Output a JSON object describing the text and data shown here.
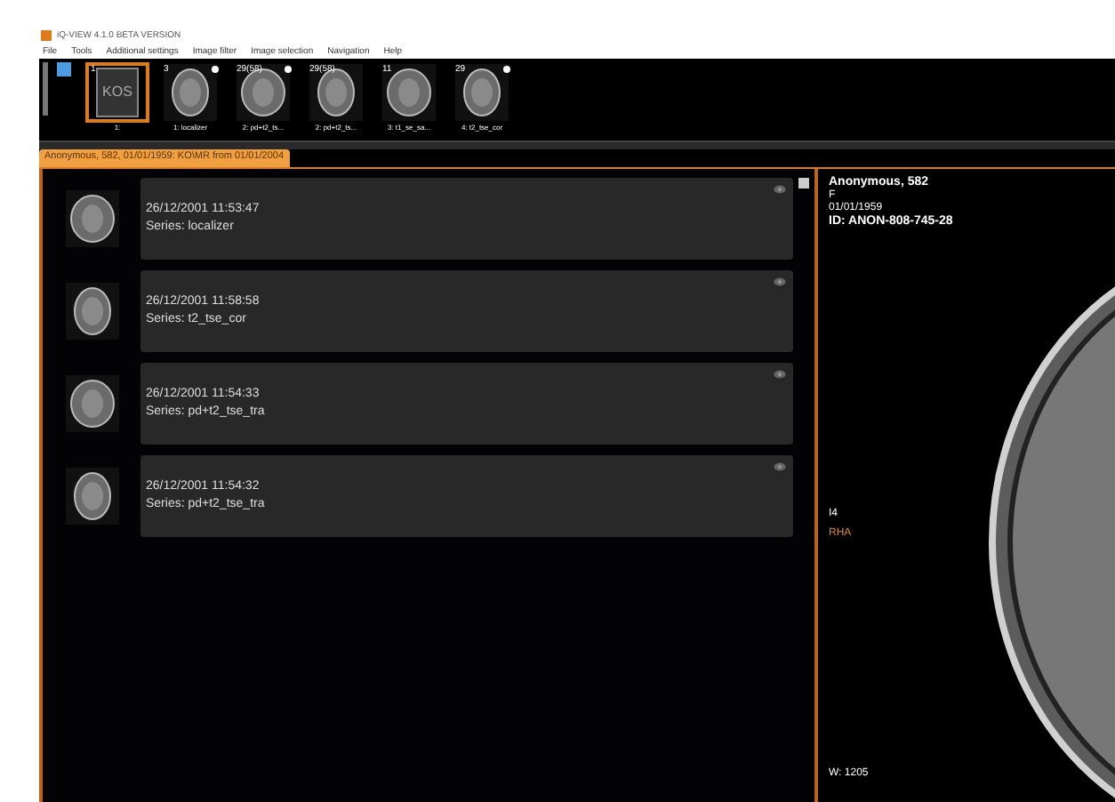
{
  "window": {
    "title": "iQ-VIEW 4.1.0 BETA VERSION"
  },
  "menu": [
    "File",
    "Tools",
    "Additional settings",
    "Image filter",
    "Image selection",
    "Navigation",
    "Help"
  ],
  "thumbnails": [
    {
      "kind": "document",
      "icon_text": "KOS",
      "count": "1",
      "label": "1:",
      "starred": false,
      "selected": true
    },
    {
      "kind": "scan",
      "count": "3",
      "label": "1: localizer",
      "starred": true,
      "selected": false
    },
    {
      "kind": "scan",
      "count": "29(58)",
      "label": "2: pd+t2_ts...",
      "starred": true,
      "selected": false
    },
    {
      "kind": "scan",
      "count": "29(58)",
      "label": "2: pd+t2_ts...",
      "starred": false,
      "selected": false
    },
    {
      "kind": "scan",
      "count": "11",
      "label": "3: t1_se_sa...",
      "starred": false,
      "selected": false
    },
    {
      "kind": "scan",
      "count": "29",
      "label": "4: t2_tse_cor",
      "starred": true,
      "selected": false
    }
  ],
  "study_tab": {
    "label": "Anonymous, 582, 01/01/1959: KO\\MR from 01/01/2004",
    "selected": true
  },
  "series_list": [
    {
      "datetime": "26/12/2001 11:53:47",
      "series": "Series: localizer"
    },
    {
      "datetime": "26/12/2001 11:58:58",
      "series": "Series: t2_tse_cor"
    },
    {
      "datetime": "26/12/2001 11:54:33",
      "series": "Series: pd+t2_tse_tra"
    },
    {
      "datetime": "26/12/2001 11:54:32",
      "series": "Series: pd+t2_tse_tra"
    }
  ],
  "viewer": {
    "patient_name": "Anonymous, 582",
    "sex": "F",
    "birth_date": "01/01/1959",
    "patient_id": "ID: ANON-808-745-28",
    "image_number": "I4",
    "orientation": "RHA",
    "window": "W: 1205"
  }
}
